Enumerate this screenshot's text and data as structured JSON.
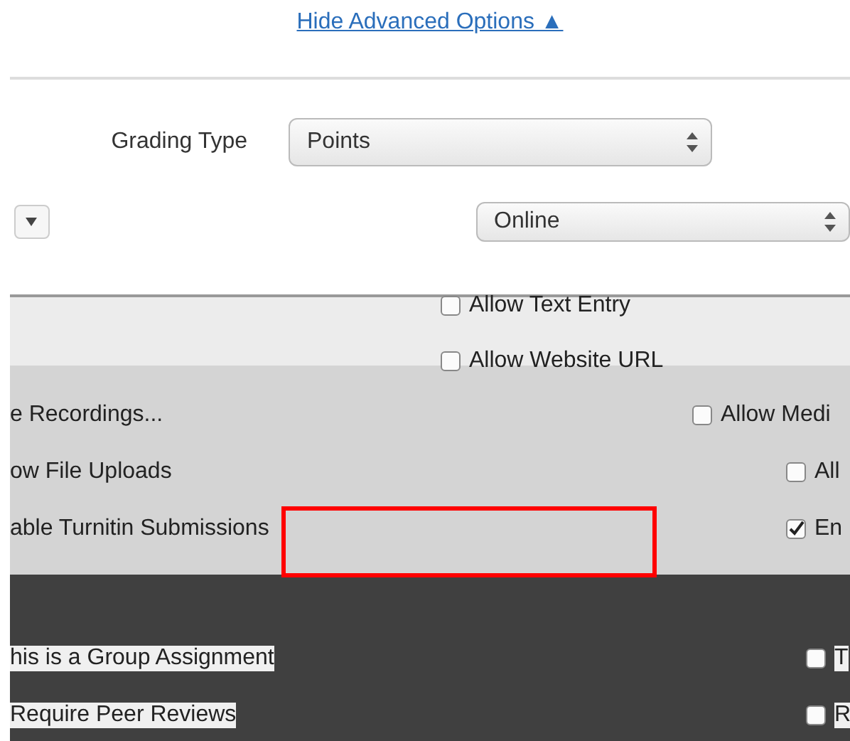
{
  "link": {
    "label": "Hide Advanced Options ▲"
  },
  "grading": {
    "label": "Grading Type",
    "value": "Points"
  },
  "submission": {
    "value": "Online"
  },
  "top_options": [
    {
      "label": "Allow Text Entry",
      "checked": false
    },
    {
      "label": "Allow Website URL",
      "checked": false
    }
  ],
  "middle_rows": [
    {
      "label": "e Recordings...",
      "option": "Allow Medi",
      "checked": false
    },
    {
      "label": "ow File Uploads",
      "option": "All",
      "checked": false
    },
    {
      "label": "able Turnitin Submissions",
      "option": "En",
      "checked": true
    }
  ],
  "bottom_rows": [
    {
      "label": "his is a Group Assignment",
      "option": "T",
      "checked": false
    },
    {
      "label": "Require Peer Reviews",
      "option": "R",
      "checked": false
    }
  ]
}
